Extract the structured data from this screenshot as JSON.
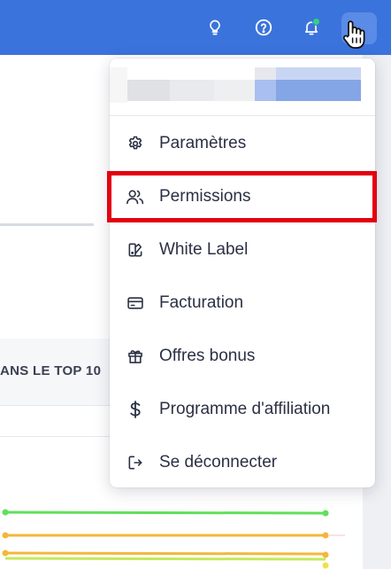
{
  "background": {
    "section_heading_fragment": "ANS LE TOP 10"
  },
  "colors": {
    "header": "#3b73dc",
    "highlight": "#e3000f",
    "notification_dot": "#36d07f"
  },
  "header": {
    "icons": [
      "lightbulb-icon",
      "help-icon",
      "bell-icon"
    ]
  },
  "menu": {
    "items": [
      {
        "label": "Paramètres",
        "icon": "gear-icon"
      },
      {
        "label": "Permissions",
        "icon": "users-icon",
        "highlighted": true
      },
      {
        "label": "White Label",
        "icon": "white-label-icon"
      },
      {
        "label": "Facturation",
        "icon": "credit-card-icon"
      },
      {
        "label": "Offres bonus",
        "icon": "gift-icon"
      },
      {
        "label": "Programme d'affiliation",
        "icon": "dollar-icon"
      },
      {
        "label": "Se déconnecter",
        "icon": "logout-icon"
      }
    ]
  }
}
